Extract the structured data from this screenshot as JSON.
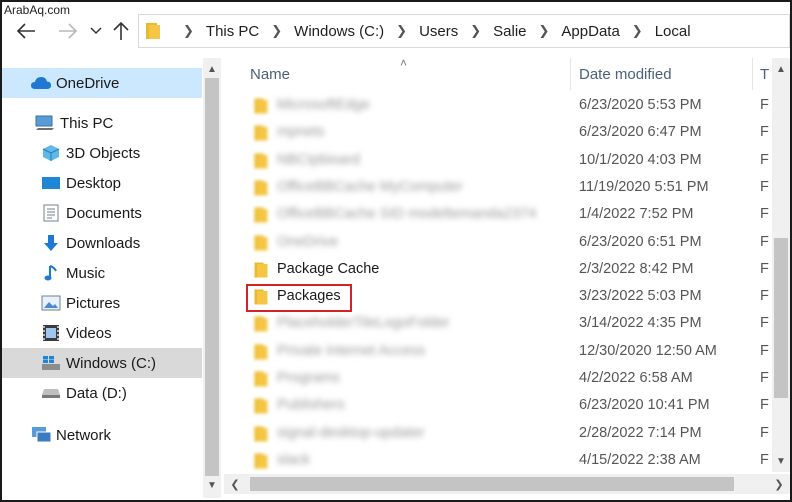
{
  "watermark": "ArabAq.com",
  "address": {
    "crumbs": [
      "This PC",
      "Windows (C:)",
      "Users",
      "Salie",
      "AppData",
      "Local"
    ]
  },
  "nav": {
    "items": [
      {
        "label": "OneDrive",
        "icon": "cloud-icon"
      },
      {
        "label": "This PC",
        "icon": "computer-icon"
      },
      {
        "label": "3D Objects",
        "icon": "cube-icon"
      },
      {
        "label": "Desktop",
        "icon": "desktop-icon"
      },
      {
        "label": "Documents",
        "icon": "document-icon"
      },
      {
        "label": "Downloads",
        "icon": "download-icon"
      },
      {
        "label": "Music",
        "icon": "music-icon"
      },
      {
        "label": "Pictures",
        "icon": "pictures-icon"
      },
      {
        "label": "Videos",
        "icon": "video-icon"
      },
      {
        "label": "Windows (C:)",
        "icon": "windows-drive-icon"
      },
      {
        "label": "Data (D:)",
        "icon": "drive-icon"
      },
      {
        "label": "Network",
        "icon": "network-icon"
      }
    ]
  },
  "list": {
    "columns": {
      "name": "Name",
      "date": "Date modified",
      "type": "T"
    },
    "rows": [
      {
        "name": "MicrosoftEdge",
        "date": "6/23/2020 5:53 PM",
        "type": "F",
        "blurred": true
      },
      {
        "name": "mpnets",
        "date": "6/23/2020 6:47 PM",
        "type": "F",
        "blurred": true
      },
      {
        "name": "NBCIpbioard",
        "date": "10/1/2020 4:03 PM",
        "type": "F",
        "blurred": true
      },
      {
        "name": "OfficeBBCache MyComputer",
        "date": "11/19/2020 5:51 PM",
        "type": "F",
        "blurred": true
      },
      {
        "name": "OfficeBBCache SID modeltemanda2374",
        "date": "1/4/2022 7:52 PM",
        "type": "F",
        "blurred": true
      },
      {
        "name": "OneDrive",
        "date": "6/23/2020 6:51 PM",
        "type": "F",
        "blurred": true
      },
      {
        "name": "Package Cache",
        "date": "2/3/2022 8:42 PM",
        "type": "F",
        "blurred": false
      },
      {
        "name": "Packages",
        "date": "3/23/2022 5:03 PM",
        "type": "F",
        "blurred": false
      },
      {
        "name": "PlaceholderTileLogoFolder",
        "date": "3/14/2022 4:35 PM",
        "type": "F",
        "blurred": true
      },
      {
        "name": "Private Internet Access",
        "date": "12/30/2020 12:50 AM",
        "type": "F",
        "blurred": true
      },
      {
        "name": "Programs",
        "date": "4/2/2022 6:58 AM",
        "type": "F",
        "blurred": true
      },
      {
        "name": "Publishers",
        "date": "6/23/2020 10:41 PM",
        "type": "F",
        "blurred": true
      },
      {
        "name": "signal-desktop-updater",
        "date": "2/28/2022 7:14 PM",
        "type": "F",
        "blurred": true
      },
      {
        "name": "slack",
        "date": "4/15/2022 2:38 AM",
        "type": "F",
        "blurred": true
      }
    ]
  },
  "colors": {
    "highlight": "#d42323",
    "folder": "#f5c644",
    "selected": "#cce8ff"
  }
}
